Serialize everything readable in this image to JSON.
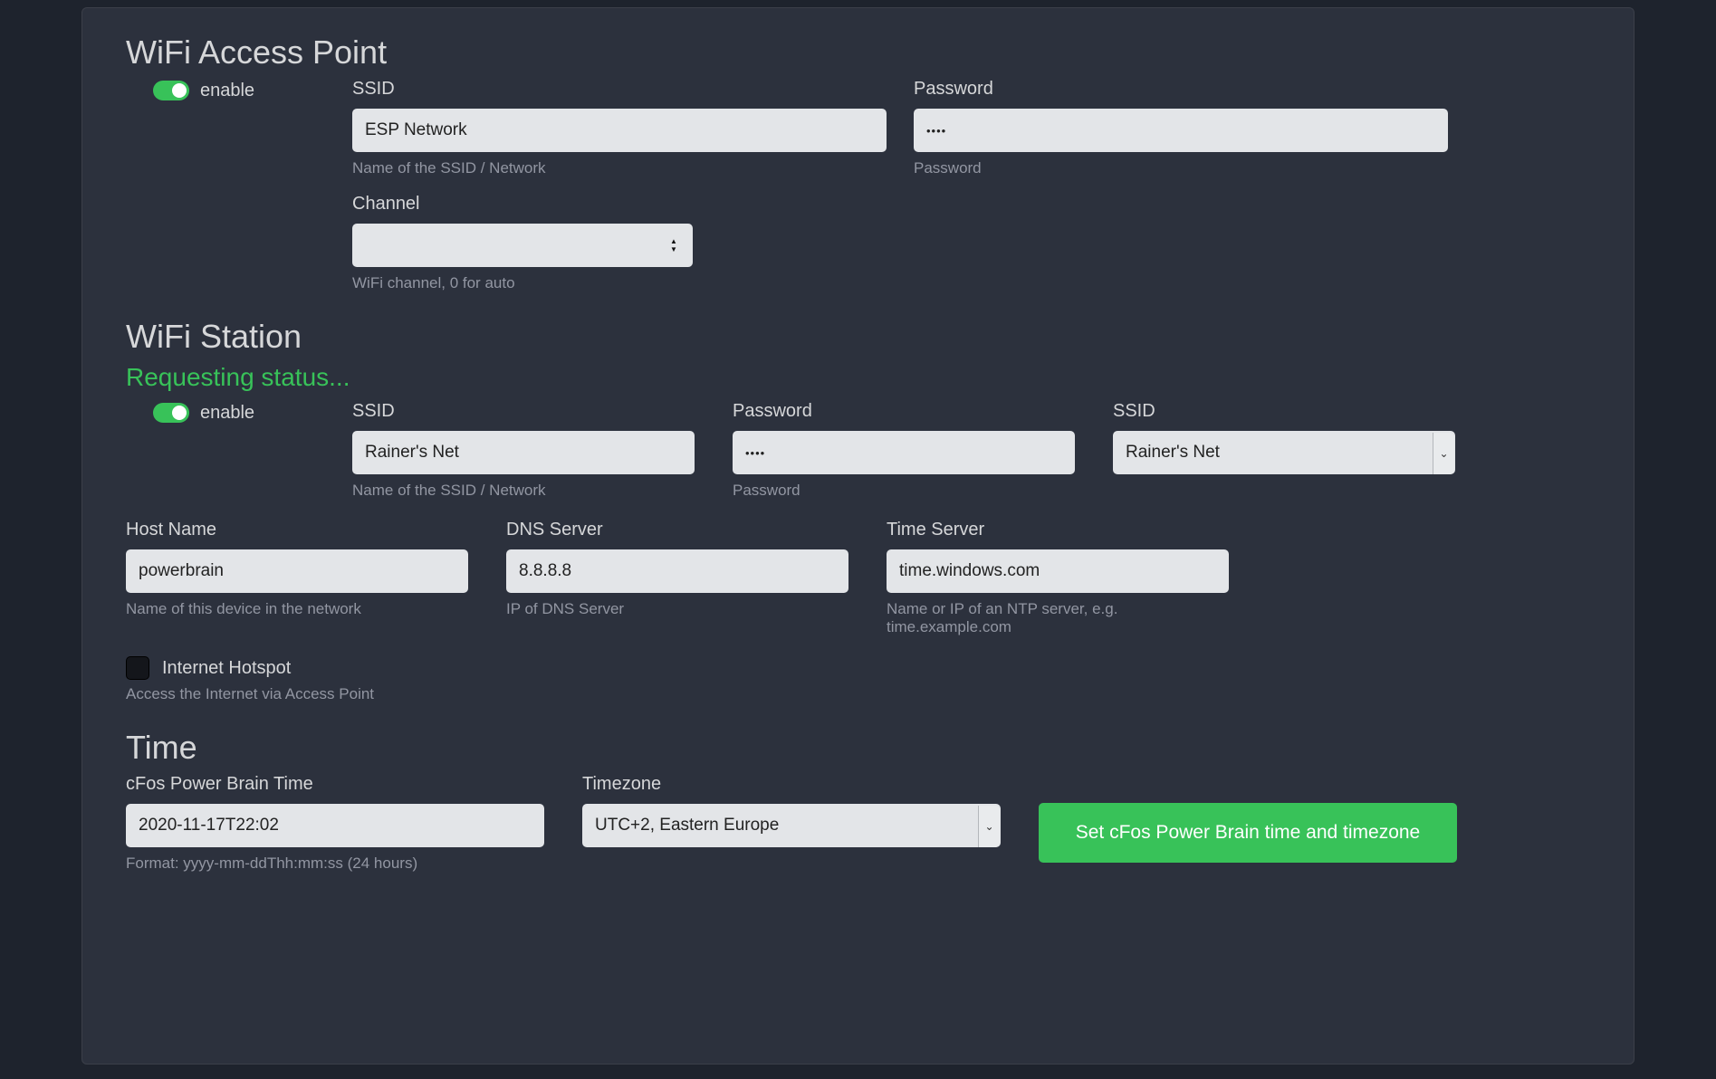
{
  "ap": {
    "title": "WiFi Access Point",
    "enable_label": "enable",
    "ssid": {
      "label": "SSID",
      "value": "ESP Network",
      "help": "Name of the SSID / Network"
    },
    "password": {
      "label": "Password",
      "value": "••••",
      "help": "Password"
    },
    "channel": {
      "label": "Channel",
      "value": "",
      "help": "WiFi channel, 0 for auto"
    }
  },
  "sta": {
    "title": "WiFi Station",
    "status": "Requesting status...",
    "enable_label": "enable",
    "ssid": {
      "label": "SSID",
      "value": "Rainer's Net",
      "help": "Name of the SSID / Network"
    },
    "password": {
      "label": "Password",
      "value": "••••",
      "help": "Password"
    },
    "ssid_select": {
      "label": "SSID",
      "value": "Rainer's Net"
    },
    "hostname": {
      "label": "Host Name",
      "value": "powerbrain",
      "help": "Name of this device in the network"
    },
    "dns": {
      "label": "DNS Server",
      "value": "8.8.8.8",
      "help": "IP of DNS Server"
    },
    "timeserver": {
      "label": "Time Server",
      "value": "time.windows.com",
      "help": "Name or IP of an NTP server, e.g. time.example.com"
    },
    "hotspot": {
      "label": "Internet Hotspot",
      "help": "Access the Internet via Access Point"
    }
  },
  "time": {
    "title": "Time",
    "pbtime": {
      "label": "cFos Power Brain Time",
      "value": "2020-11-17T22:02",
      "help": "Format: yyyy-mm-ddThh:mm:ss (24 hours)"
    },
    "timezone": {
      "label": "Timezone",
      "value": "UTC+2, Eastern Europe"
    },
    "set_button": "Set cFos Power Brain time and timezone"
  }
}
